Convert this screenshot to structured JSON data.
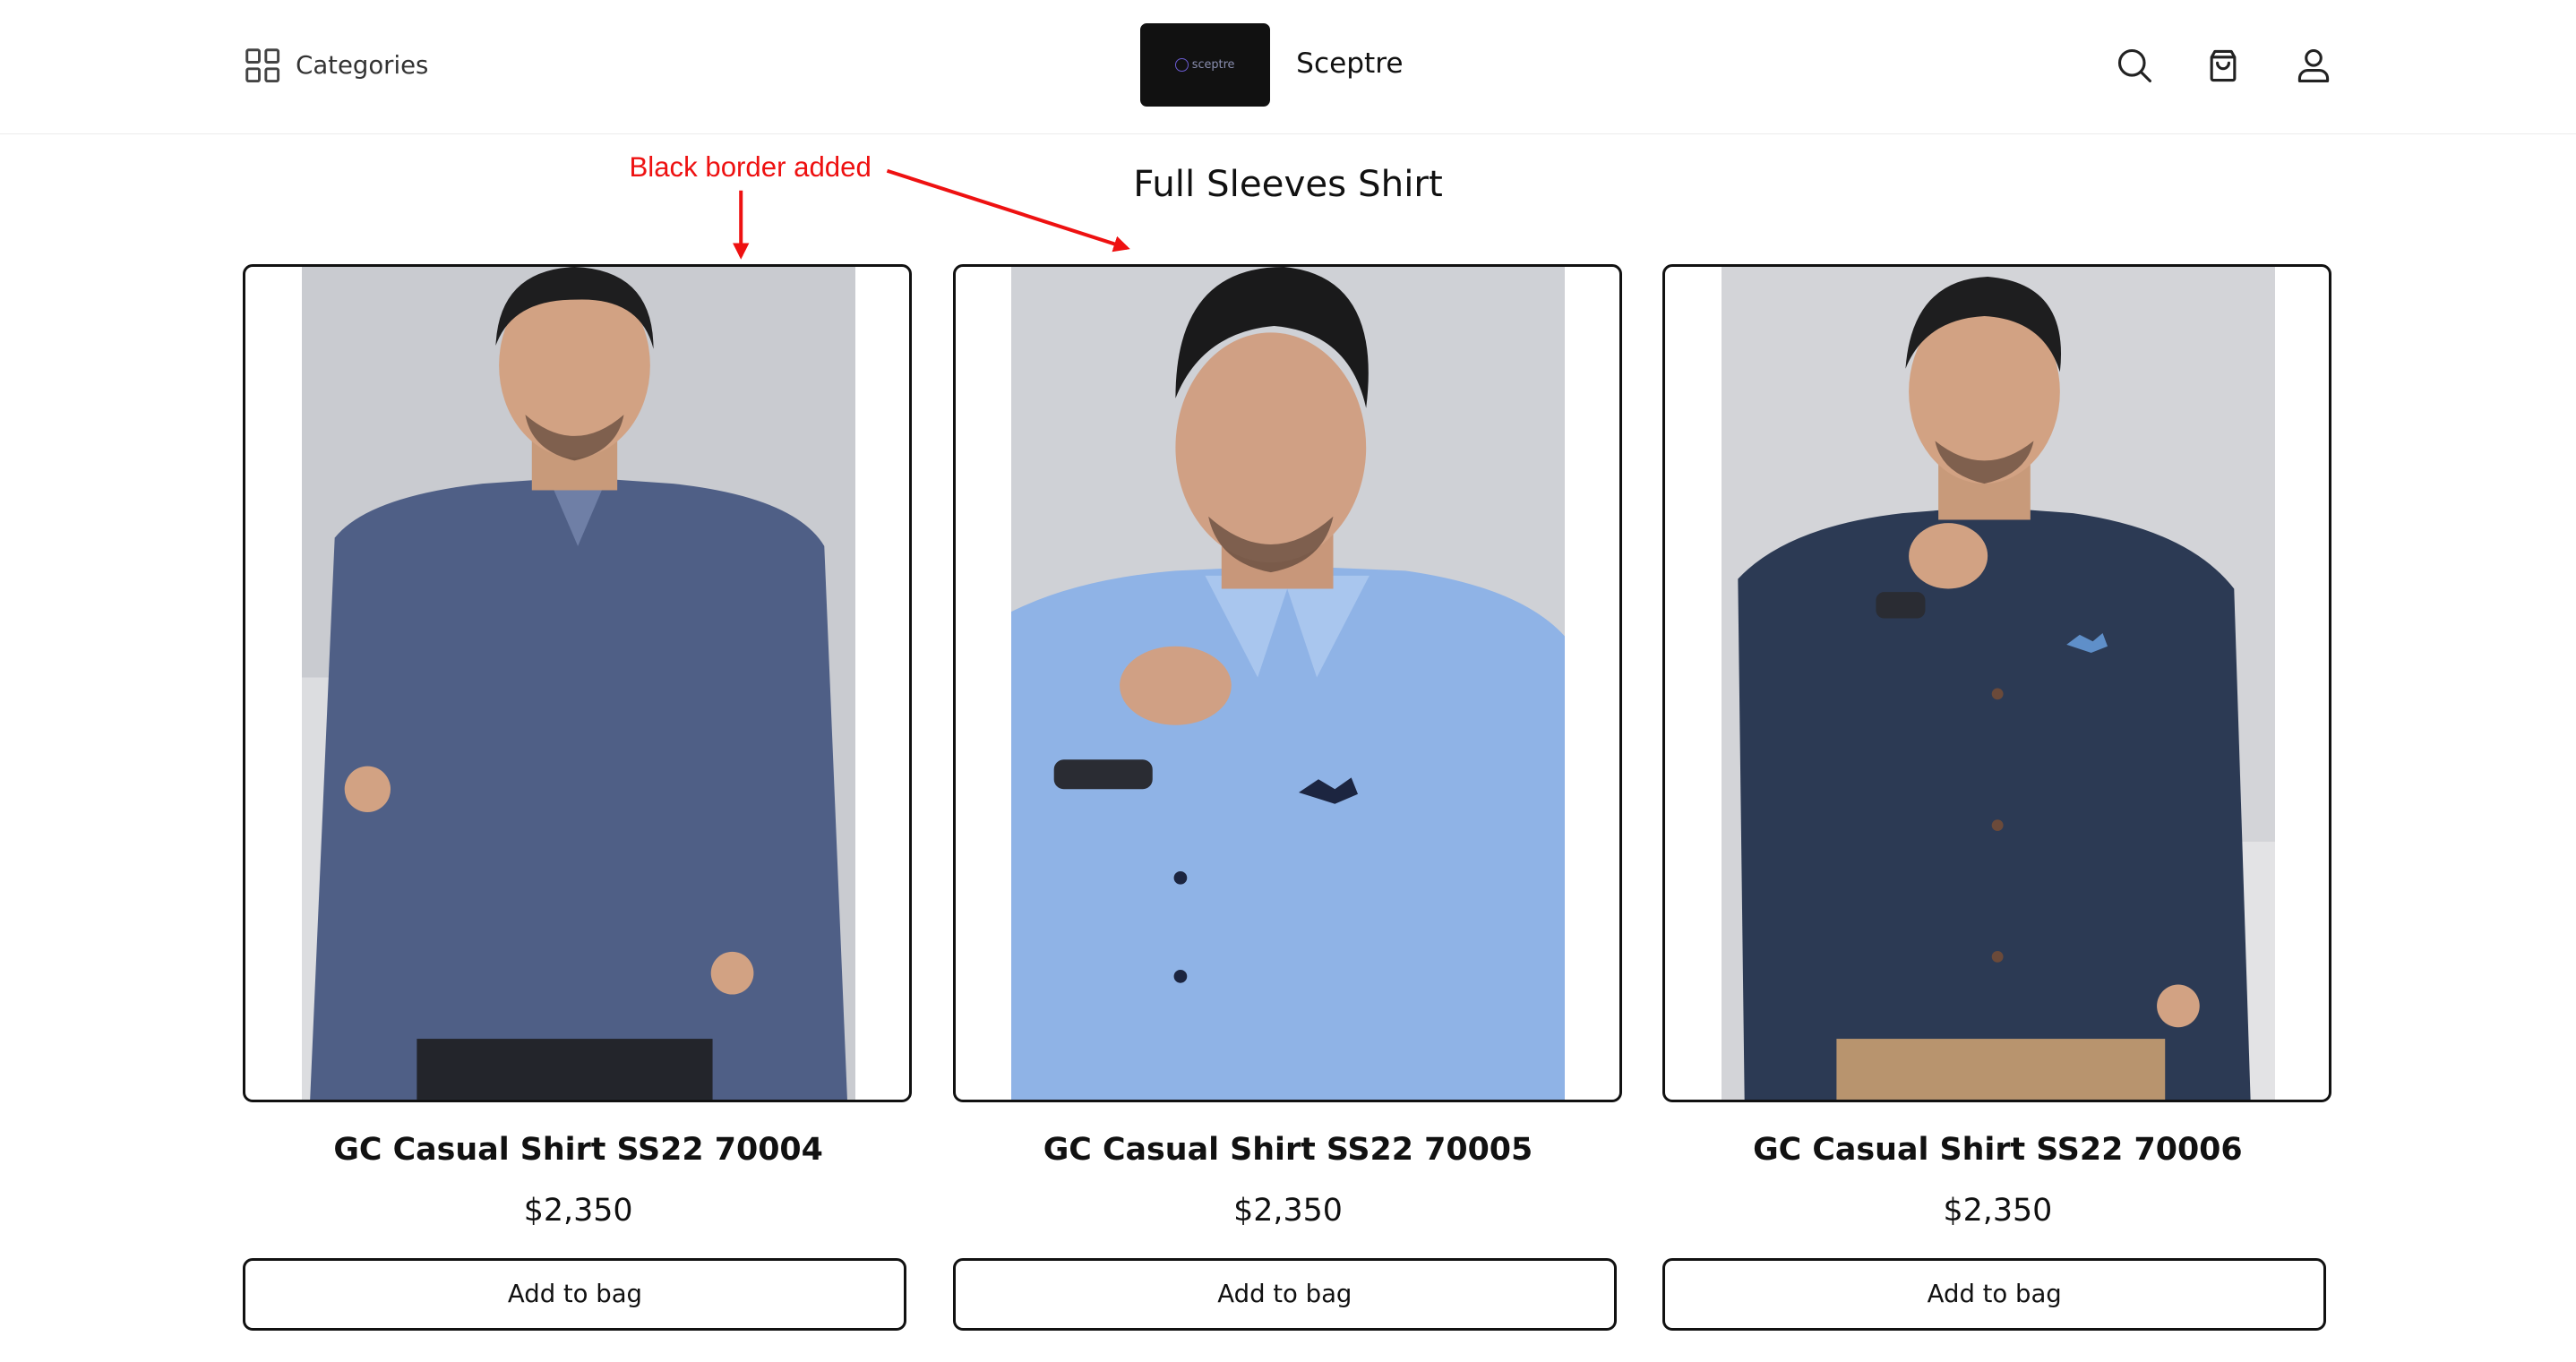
{
  "header": {
    "categories_label": "Categories",
    "logo_text": "sceptre",
    "brand_name": "Sceptre",
    "icons": [
      "grid-icon",
      "search-icon",
      "bag-icon",
      "user-icon"
    ]
  },
  "annotation": {
    "text": "Black border added",
    "color": "#ee1111"
  },
  "page": {
    "title": "Full Sleeves Shirt"
  },
  "products": [
    {
      "name": "GC Casual Shirt SS22 70004",
      "price": "$2,350",
      "button": "Add to bag",
      "shirt_color": "#4f5f86"
    },
    {
      "name": "GC Casual Shirt SS22 70005",
      "price": "$2,350",
      "button": "Add to bag",
      "shirt_color": "#8fb3e6"
    },
    {
      "name": "GC Casual Shirt SS22 70006",
      "price": "$2,350",
      "button": "Add to bag",
      "shirt_color": "#2c3a54"
    }
  ]
}
